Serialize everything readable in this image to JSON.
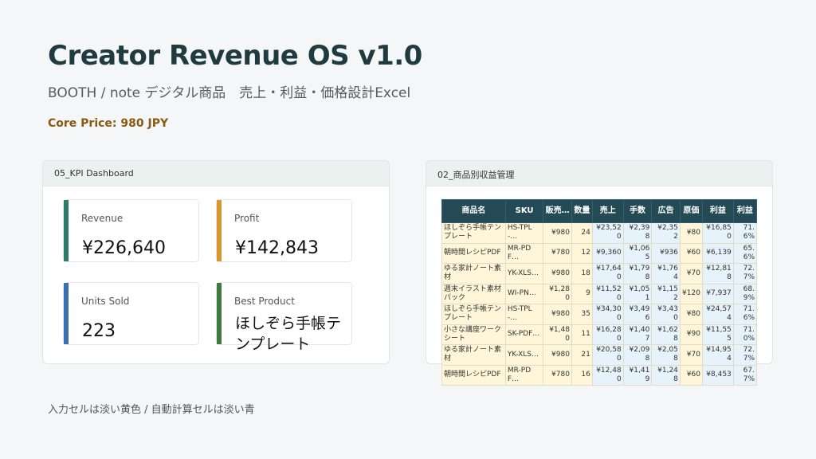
{
  "header": {
    "title": "Creator Revenue OS v1.0",
    "subtitle": "BOOTH / note デジタル商品　売上・利益・価格設計Excel",
    "core_price": "Core Price: 980 JPY"
  },
  "colors": {
    "title": "#1f3b40",
    "core_price": "#8a5a12",
    "table_header": "#244a56",
    "input_cell": "#fff6d9",
    "calc_cell": "#e6f3fa",
    "kpi_revenue": "#2e7d6b",
    "kpi_profit": "#d9962b",
    "kpi_units": "#3a6fb0",
    "kpi_best": "#3f7b3f"
  },
  "kpi_panel": {
    "title": "05_KPI Dashboard",
    "cards": [
      {
        "label": "Revenue",
        "value": "¥226,640",
        "color": "#2e7d6b"
      },
      {
        "label": "Profit",
        "value": "¥142,843",
        "color": "#d9962b"
      },
      {
        "label": "Units Sold",
        "value": "223",
        "color": "#3a6fb0"
      },
      {
        "label": "Best Product",
        "value": "ほしぞら手帳テンプレート",
        "color": "#3f7b3f"
      }
    ]
  },
  "table_panel": {
    "title": "02_商品別収益管理",
    "columns": [
      "商品名",
      "SKU",
      "販売…",
      "数量",
      "売上",
      "手数",
      "広告",
      "原価",
      "利益",
      "利益"
    ],
    "rows": [
      [
        "ほしぞら手帳テンプレート",
        "HS-TPL-…",
        "¥980",
        "24",
        "¥23,520",
        "¥2,398",
        "¥2,352",
        "¥80",
        "¥16,850",
        "71.6%"
      ],
      [
        "朝時間レシピPDF",
        "MR-PDF…",
        "¥780",
        "12",
        "¥9,360",
        "¥1,065",
        "¥936",
        "¥60",
        "¥6,139",
        "65.6%"
      ],
      [
        "ゆる家計ノート素材",
        "YK-XLS…",
        "¥980",
        "18",
        "¥17,640",
        "¥1,798",
        "¥1,764",
        "¥70",
        "¥12,818",
        "72.7%"
      ],
      [
        "週末イラスト素材パック",
        "WI-PN…",
        "¥1,280",
        "9",
        "¥11,520",
        "¥1,051",
        "¥1,152",
        "¥120",
        "¥7,937",
        "68.9%"
      ],
      [
        "ほしぞら手帳テンプレート",
        "HS-TPL-…",
        "¥980",
        "35",
        "¥34,300",
        "¥3,496",
        "¥3,430",
        "¥80",
        "¥24,574",
        "71.6%"
      ],
      [
        "小さな講座ワークシート",
        "SK-PDF…",
        "¥1,480",
        "11",
        "¥16,280",
        "¥1,407",
        "¥1,628",
        "¥90",
        "¥11,555",
        "71.0%"
      ],
      [
        "ゆる家計ノート素材",
        "YK-XLS…",
        "¥980",
        "21",
        "¥20,580",
        "¥2,098",
        "¥2,058",
        "¥70",
        "¥14,954",
        "72.7%"
      ],
      [
        "朝時間レシピPDF",
        "MR-PDF…",
        "¥780",
        "16",
        "¥12,480",
        "¥1,419",
        "¥1,248",
        "¥60",
        "¥8,453",
        "67.7%"
      ]
    ]
  },
  "footnote": "入力セルは淡い黄色 / 自動計算セルは淡い青"
}
